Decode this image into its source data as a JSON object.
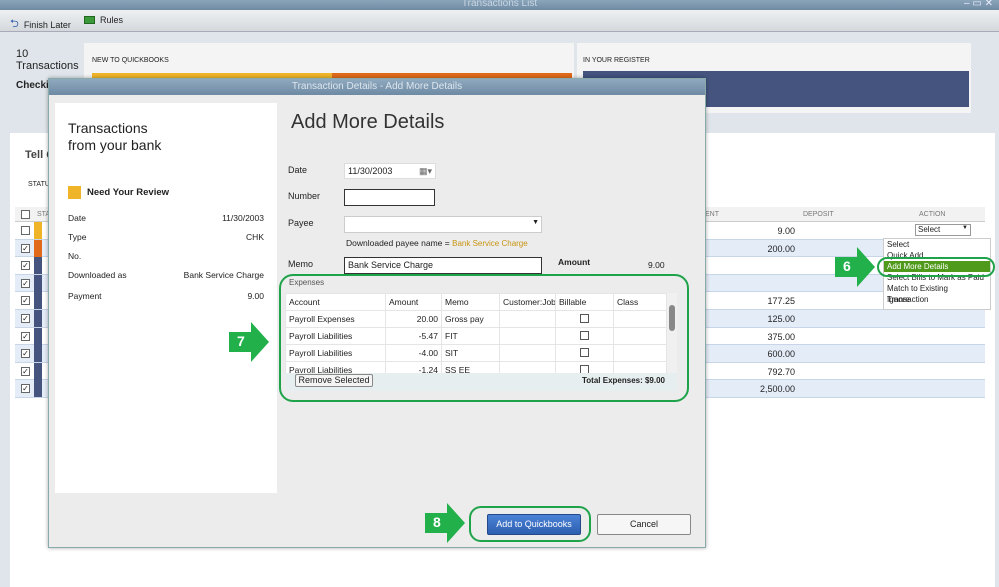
{
  "window": {
    "title": "Transactions List"
  },
  "toolbar": {
    "finish_later": "Finish Later",
    "rules": "Rules"
  },
  "summary": {
    "count": "10",
    "count_label": "Transactions",
    "account": "Checking",
    "new_label": "NEW TO QUICKBOOKS",
    "register_label": "IN YOUR REGISTER"
  },
  "main": {
    "tell_label": "Tell Q",
    "status_label": "STATU",
    "col_status": "STA",
    "col_payment": "ENT",
    "col_deposit": "DEPOSIT",
    "col_action": "ACTION",
    "rows": [
      {
        "payment": "9.00",
        "action": "Select",
        "checked": false,
        "color": "#f0b429"
      },
      {
        "payment": "200.00",
        "checked": true,
        "color": "#e06a1a"
      },
      {
        "payment": "",
        "checked": true,
        "color": "#44547f"
      },
      {
        "payment": "",
        "checked": true,
        "color": "#44547f"
      },
      {
        "payment": "177.25",
        "checked": true,
        "color": "#44547f"
      },
      {
        "payment": "125.00",
        "checked": true,
        "color": "#44547f"
      },
      {
        "payment": "375.00",
        "checked": true,
        "color": "#44547f"
      },
      {
        "payment": "600.00",
        "checked": true,
        "color": "#44547f"
      },
      {
        "payment": "792.70",
        "checked": true,
        "color": "#44547f"
      },
      {
        "payment": "2,500.00",
        "checked": true,
        "color": "#44547f"
      }
    ]
  },
  "action_menu": {
    "items": [
      "Select",
      "Quick Add",
      "Add More Details",
      "Select Bills to Mark as Paid",
      "Match to Existing Transaction",
      "Ignore"
    ],
    "selected": "Add More Details"
  },
  "dialog": {
    "title": "Transaction Details - Add More Details",
    "left_title_1": "Transactions",
    "left_title_2": "from your bank",
    "review_label": "Need Your Review",
    "details": [
      {
        "label": "Date",
        "value": "11/30/2003"
      },
      {
        "label": "Type",
        "value": "CHK"
      },
      {
        "label": "No.",
        "value": ""
      },
      {
        "label": "Downloaded as",
        "value": "Bank Service Charge"
      },
      {
        "label": "Payment",
        "value": "9.00"
      }
    ],
    "heading": "Add More Details",
    "form": {
      "date_label": "Date",
      "date": "11/30/2003",
      "number_label": "Number",
      "number": "",
      "payee_label": "Payee",
      "payee": "",
      "downloaded_payee_label": "Downloaded payee name =",
      "downloaded_payee": "Bank Service Charge",
      "memo_label": "Memo",
      "memo": "Bank Service Charge",
      "amount_label": "Amount",
      "amount": "9.00"
    },
    "expenses": {
      "label": "Expenses",
      "columns": [
        "Account",
        "Amount",
        "Memo",
        "Customer:Job",
        "Billable",
        "Class"
      ],
      "rows": [
        {
          "account": "Payroll Expenses",
          "amount": "20.00",
          "memo": "Gross pay"
        },
        {
          "account": "Payroll Liabilities",
          "amount": "-5.47",
          "memo": "FIT"
        },
        {
          "account": "Payroll Liabilities",
          "amount": "-4.00",
          "memo": "SIT"
        },
        {
          "account": "Payroll Liabilities",
          "amount": "-1.24",
          "memo": "SS EE"
        }
      ],
      "remove_selected": "Remove Selected",
      "total": "Total Expenses: $9.00"
    },
    "add_button": "Add to Quickbooks",
    "cancel_button": "Cancel"
  },
  "callouts": [
    "6",
    "7",
    "8"
  ],
  "colors": {
    "accent_green": "#1fa34a",
    "menu_highlight": "#4f9a1a",
    "primary_button": "#3a6fc4"
  }
}
